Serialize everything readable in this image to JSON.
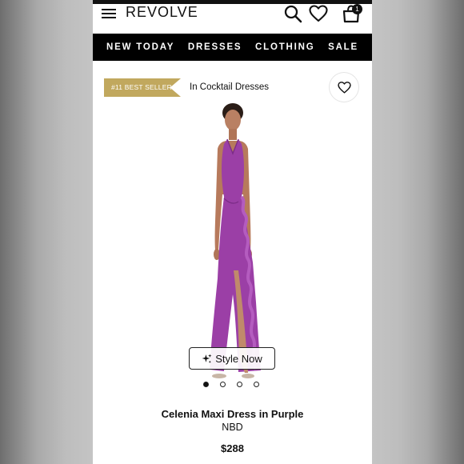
{
  "header": {
    "logo": "REVOLVE",
    "bag_count": "1"
  },
  "nav": {
    "items": [
      {
        "label": "NEW TODAY"
      },
      {
        "label": "DRESSES"
      },
      {
        "label": "CLOTHING"
      },
      {
        "label": "SALE"
      }
    ]
  },
  "product": {
    "badge": "#11 BEST SELLER",
    "category": "In Cocktail Dresses",
    "style_now_label": "Style Now",
    "name": "Celenia Maxi Dress in Purple",
    "brand": "NBD",
    "price": "$288",
    "image_count": 4,
    "active_image": 1,
    "dress_color": "#9b3fa6"
  },
  "icons": [
    "menu-icon",
    "search-icon",
    "heart-icon",
    "shopping-bag-icon",
    "sparkle-icon"
  ],
  "colors": {
    "nav_bg": "#000000",
    "badge_bg": "#c1a85e",
    "page_bg": "#ffffff"
  }
}
